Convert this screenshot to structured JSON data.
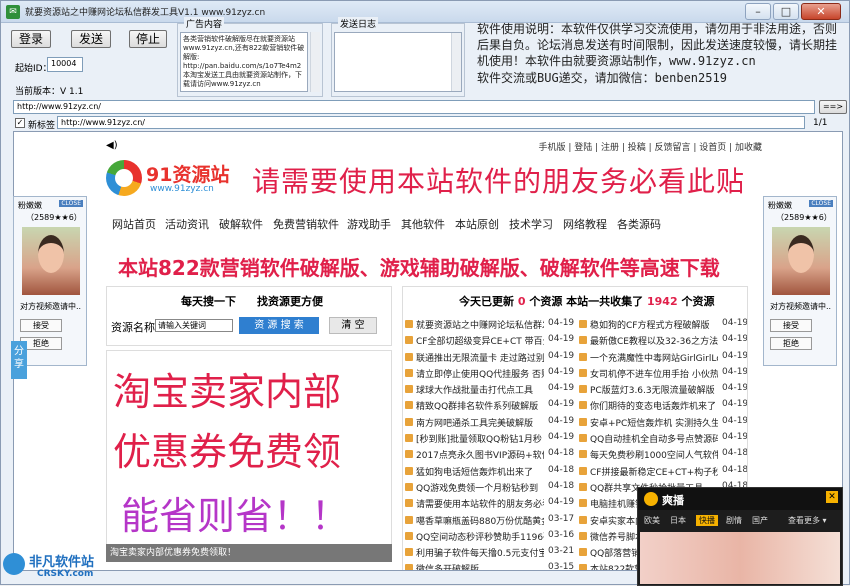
{
  "window": {
    "title": "就要资源站之中赚网论坛私信群发工具V1.1   www.91zyz.cn",
    "minimize": "–",
    "maximize": "□",
    "close": "✕"
  },
  "controls": {
    "login": "登录",
    "send": "发送",
    "stop": "停止",
    "start_id_label": "起始ID：",
    "start_id_value": "10004",
    "version_label": "当前版本：V 1.1"
  },
  "ad": {
    "group_title": "广告内容",
    "text": "各类营销软件破解版尽在就要资源站 www.91zyz.cn,还有822款营销软件破解版: http://pan.baidu.com/s/1o7Te4m2 本淘宝发送工具由就要资源站制作，下载请访问www.91zyz.cn"
  },
  "log": {
    "group_title": "发送日志"
  },
  "notice": {
    "text": "软件使用说明：本软件仅供学习交流使用，请勿用于非法用途，否则后果自负。论坛消息发送有时间限制，因此发送速度较慢，请长期挂机使用！本软件由就要资源站制作，www.91zyz.cn",
    "contact": "软件交流或BUG递交，请加微信：benben2519"
  },
  "address": {
    "url": "http://www.91zyz.cn/",
    "go": "==>",
    "newtab_label": "新标签",
    "tab_url": "http://www.91zyz.cn/",
    "page": "1/1"
  },
  "site": {
    "topnav": "手机版 | 登陆 | 注册 | 投稿 | 反馈留言 | 设首页 | 加收藏",
    "brand": "91资源站",
    "brand_url": "www.91zyz.cn",
    "headline": "请需要使用本站软件的朋友务必看此贴",
    "menu": [
      "网站首页",
      "活动资讯",
      "破解软件",
      "免费营销软件",
      "游戏助手",
      "其他软件",
      "本站原创",
      "技术学习",
      "网络教程",
      "各类源码"
    ],
    "banner": "本站822款营销软件破解版、游戏辅助破解版、破解软件等高速下载",
    "search": {
      "t1": "每天搜一下",
      "t2": "找资源更方便",
      "label": "资源名称",
      "placeholder": "请输入关键词",
      "submit": "资 源 搜 索",
      "clear": "清 空"
    },
    "bigad": {
      "l1": "淘宝卖家内部",
      "l2": "优惠券免费领",
      "l3": "能省则省！！"
    },
    "adbar": "淘宝卖家内部优惠券免费领取！",
    "list_header": {
      "pre": "今天已更新 ",
      "today": "0",
      "mid": " 个资源    本站一共收集了 ",
      "total": "1942",
      "post": " 个资源"
    },
    "list_left": [
      {
        "t": "就要资源站之中赚网论坛私信群发",
        "d": "04-19"
      },
      {
        "t": "CF全部切超级变异CE+CT 带百分",
        "d": "04-19"
      },
      {
        "t": "联通推出无限流量卡 走过路过别",
        "d": "04-19"
      },
      {
        "t": "请立即停止使用QQ代挂服务 否则",
        "d": "04-19"
      },
      {
        "t": "球球大作战批量击打代点工具",
        "d": "04-19"
      },
      {
        "t": "精致QQ群排名软件系列破解版",
        "d": "04-19"
      },
      {
        "t": "南方网吧通杀工具完美破解版",
        "d": "04-19"
      },
      {
        "t": "[秒到账]批量领取QQ粉钻1月秒",
        "d": "04-19"
      },
      {
        "t": "2017点亮永久图书VIP源码+软件",
        "d": "04-18"
      },
      {
        "t": "猛如狗电话短信轰炸机出来了",
        "d": "04-18"
      },
      {
        "t": "QQ游戏免费领一个月粉钻秒到",
        "d": "04-18"
      },
      {
        "t": "请需要使用本站软件的朋友务必看",
        "d": "04-19"
      },
      {
        "t": "噶香草嘛瓶盖码880万份优酷黄金",
        "d": "03-17"
      },
      {
        "t": "QQ空间动态秒评秒赞助手1196破",
        "d": "03-16"
      },
      {
        "t": "利用骗子软件每天撸0.5元支付宝",
        "d": "03-21"
      },
      {
        "t": "微信多开破解版",
        "d": "03-15"
      }
    ],
    "list_right": [
      {
        "t": "稳如狗的CF方程式方程破解版",
        "d": "04-19"
      },
      {
        "t": "最新傲CE教程以及32-36之方法",
        "d": "04-19"
      },
      {
        "t": "一个充满魔性中毒网站GirlGirlLov",
        "d": "04-19"
      },
      {
        "t": "女司机停不进车位用手抬 小伙热",
        "d": "04-19"
      },
      {
        "t": "PC版蓝灯3.6.3无限流量破解版",
        "d": "04-19"
      },
      {
        "t": "你们期待的变态电话轰炸机来了",
        "d": "04-19"
      },
      {
        "t": "安卓+PC短信轰炸机 实测持久生",
        "d": "04-19"
      },
      {
        "t": "QQ自动挂机全自动多号点赞源码+成",
        "d": "04-19"
      },
      {
        "t": "每天免费秒刷1000空间人气软件",
        "d": "04-18"
      },
      {
        "t": "CF拼接最新稳定CE+CT+构子秒",
        "d": "04-18"
      },
      {
        "t": "QQ群共享文件秒抢批量工具",
        "d": "04-18"
      },
      {
        "t": "电脑挂机赚钱软件",
        "d": "04-18"
      },
      {
        "t": "安卓实家本内部",
        "d": "04-18"
      },
      {
        "t": "微信养号脚本",
        "d": "04-18"
      },
      {
        "t": "QQ部落营销工具",
        "d": "04-18"
      },
      {
        "t": "本站822款营销",
        "d": "04-18"
      }
    ]
  },
  "chat": {
    "name": "粉嫩嫩",
    "sub": "（2589★★6）",
    "badge": "CLOSE",
    "msg": "对方视频邀请中..",
    "accept": "接受",
    "reject": "拒绝"
  },
  "share": "分享",
  "video": {
    "title": "爽播",
    "close": "✕",
    "tabs": [
      "欧美",
      "日本",
      "快播",
      "剧情",
      "国产",
      "查看更多 ▾"
    ]
  },
  "watermark": {
    "name": "非凡软件站",
    "url": "CRSKY.com"
  }
}
